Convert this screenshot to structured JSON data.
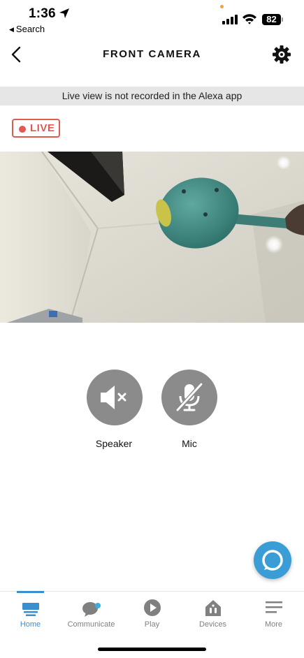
{
  "status_bar": {
    "time": "1:36",
    "back_label": "Search",
    "battery": "82"
  },
  "nav": {
    "title": "FRONT CAMERA",
    "back_icon": "chevron-left-icon",
    "settings_icon": "gear-icon"
  },
  "banner": {
    "text": "Live view is not recorded in the Alexa app"
  },
  "live_badge": {
    "label": "LIVE",
    "color": "#e05a52"
  },
  "controls": {
    "speaker_label": "Speaker",
    "mic_label": "Mic",
    "button_color": "#8b8b8b"
  },
  "alexa_button": {
    "icon": "alexa-ring-icon",
    "color": "#3a9dd6"
  },
  "tabs": [
    {
      "label": "Home",
      "icon": "home-icon",
      "active": true
    },
    {
      "label": "Communicate",
      "icon": "chat-bubble-icon",
      "active": false
    },
    {
      "label": "Play",
      "icon": "play-icon",
      "active": false
    },
    {
      "label": "Devices",
      "icon": "devices-icon",
      "active": false
    },
    {
      "label": "More",
      "icon": "menu-icon",
      "active": false
    }
  ],
  "colors": {
    "accent": "#3a8fcf",
    "inactive": "#808080",
    "banner_bg": "#e6e6e6"
  }
}
